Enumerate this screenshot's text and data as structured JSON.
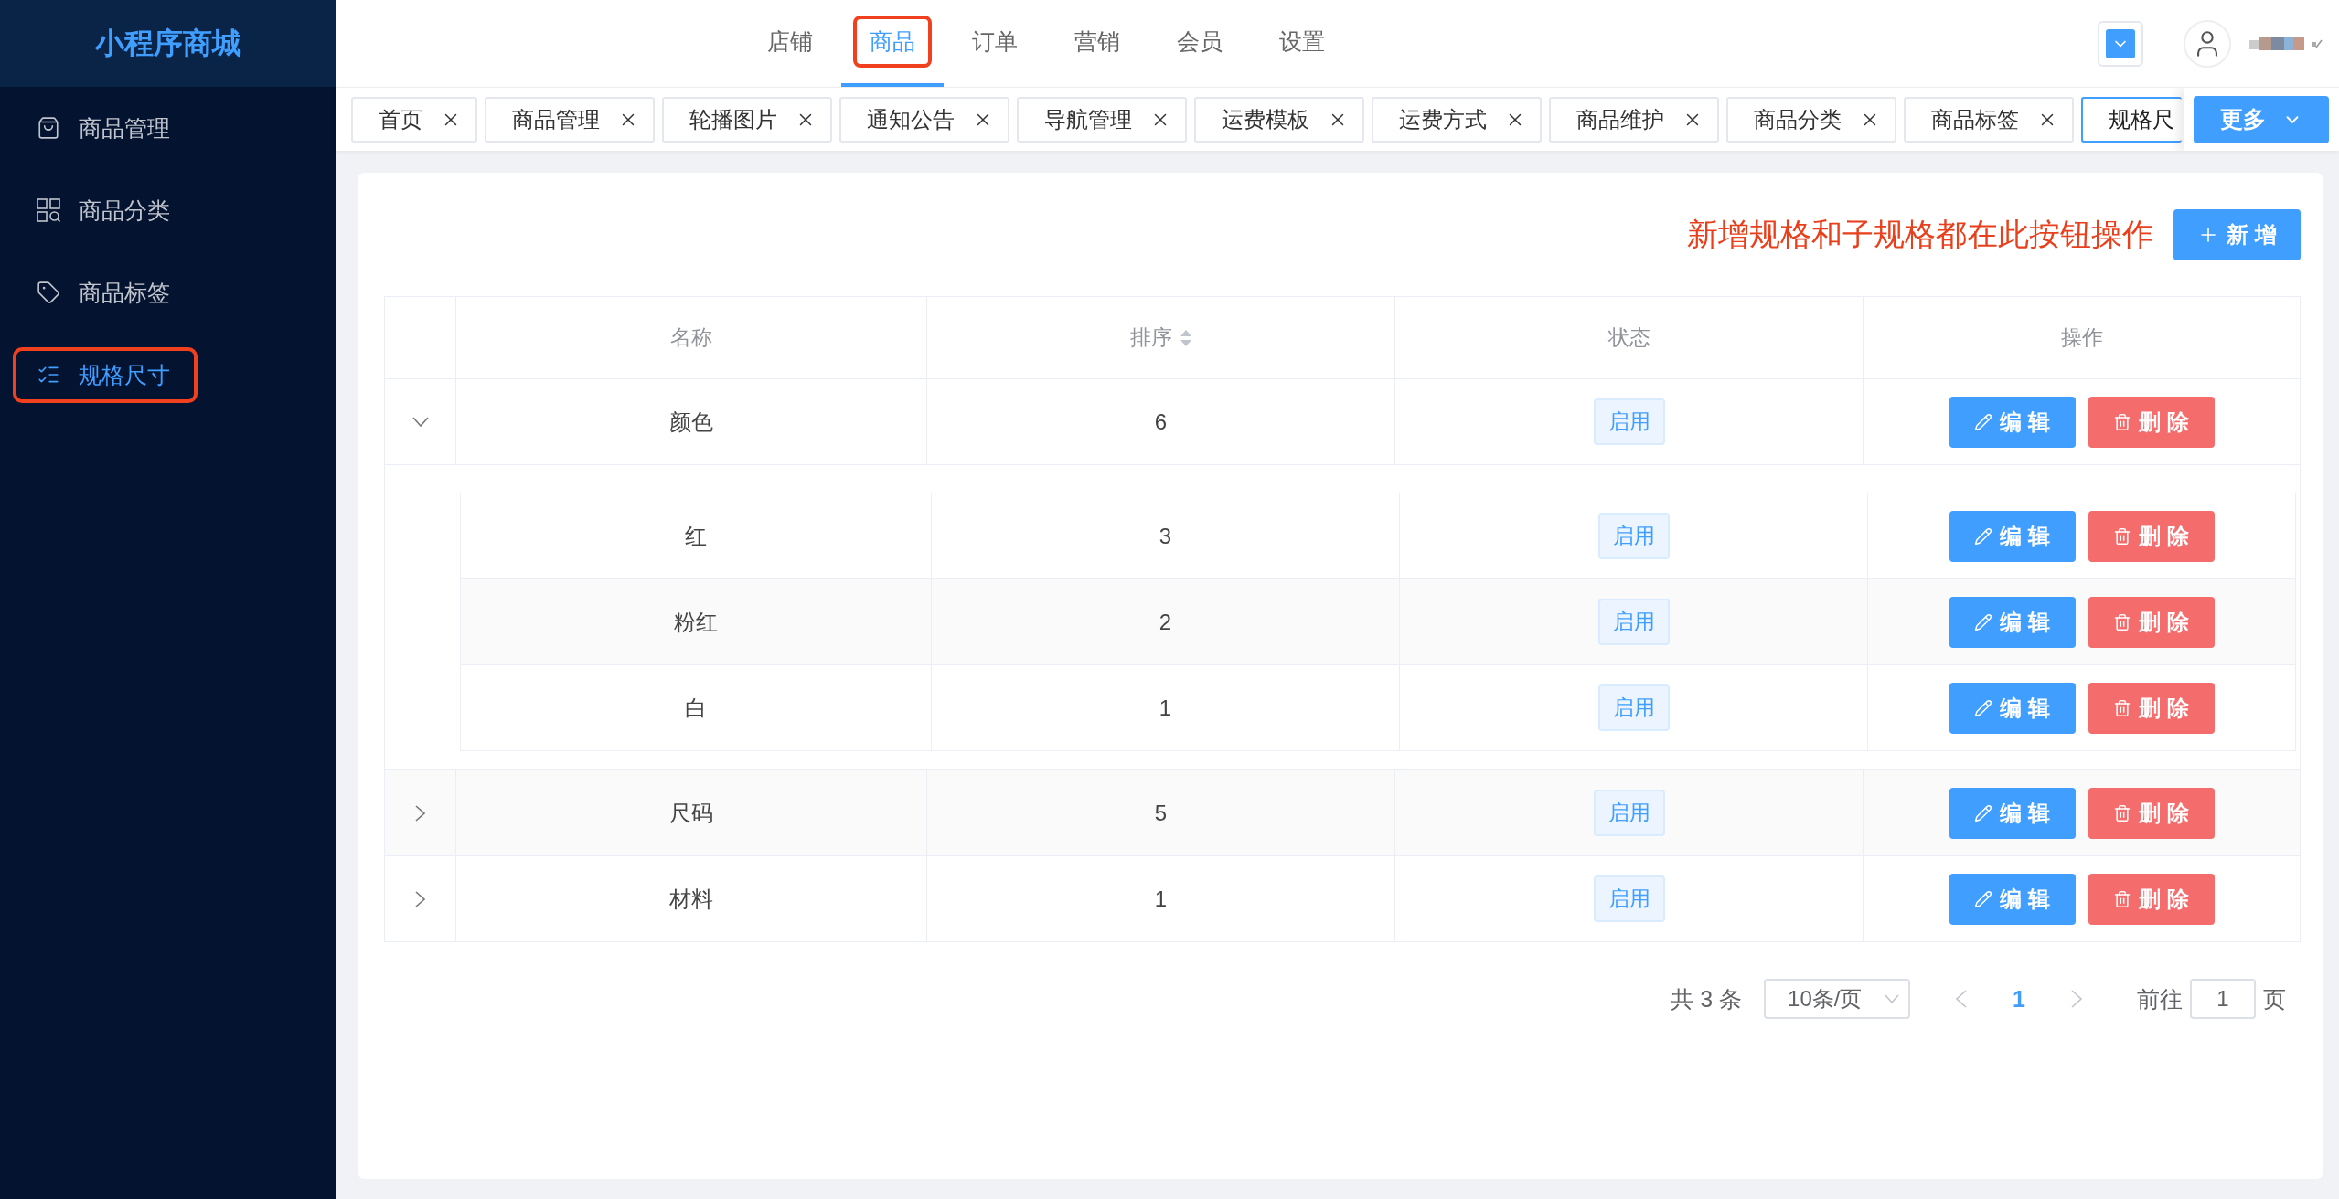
{
  "app": {
    "logo": "小程序商城"
  },
  "sidebar": {
    "items": [
      {
        "label": "商品管理",
        "kind": "bag",
        "selected": false,
        "annotated": false
      },
      {
        "label": "商品分类",
        "kind": "grid",
        "selected": false,
        "annotated": false
      },
      {
        "label": "商品标签",
        "kind": "tag",
        "selected": false,
        "annotated": false
      },
      {
        "label": "规格尺寸",
        "kind": "list",
        "selected": true,
        "annotated": true
      }
    ]
  },
  "top_nav": {
    "items": [
      {
        "label": "店铺",
        "selected": false,
        "annotated": false
      },
      {
        "label": "商品",
        "selected": true,
        "annotated": true
      },
      {
        "label": "订单",
        "selected": false,
        "annotated": false
      },
      {
        "label": "营销",
        "selected": false,
        "annotated": false
      },
      {
        "label": "会员",
        "selected": false,
        "annotated": false
      },
      {
        "label": "设置",
        "selected": false,
        "annotated": false
      }
    ]
  },
  "tabs": {
    "items": [
      {
        "label": "首页",
        "selected": false,
        "closable": true
      },
      {
        "label": "商品管理",
        "selected": false,
        "closable": true
      },
      {
        "label": "轮播图片",
        "selected": false,
        "closable": true
      },
      {
        "label": "通知公告",
        "selected": false,
        "closable": true
      },
      {
        "label": "导航管理",
        "selected": false,
        "closable": true
      },
      {
        "label": "运费模板",
        "selected": false,
        "closable": true
      },
      {
        "label": "运费方式",
        "selected": false,
        "closable": true
      },
      {
        "label": "商品维护",
        "selected": false,
        "closable": true
      },
      {
        "label": "商品分类",
        "selected": false,
        "closable": true
      },
      {
        "label": "商品标签",
        "selected": false,
        "closable": true
      },
      {
        "label": "规格尺",
        "selected": true,
        "closable": false
      }
    ],
    "more": "更多"
  },
  "toolbar": {
    "note": "新增规格和子规格都在此按钮操作",
    "add_button": "新 增"
  },
  "table": {
    "columns": [
      {
        "label": "名称",
        "sortable": false
      },
      {
        "label": "排序",
        "sortable": true
      },
      {
        "label": "状态",
        "sortable": false
      },
      {
        "label": "操作",
        "sortable": false
      }
    ],
    "rows": [
      {
        "name": "颜色",
        "sort": "6",
        "status": "启用",
        "edit": "编 辑",
        "delete": "删 除",
        "expanded": true,
        "children": [
          {
            "name": "红",
            "sort": "3",
            "status": "启用",
            "edit": "编 辑",
            "delete": "删 除"
          },
          {
            "name": "粉红",
            "sort": "2",
            "status": "启用",
            "edit": "编 辑",
            "delete": "删 除"
          },
          {
            "name": "白",
            "sort": "1",
            "status": "启用",
            "edit": "编 辑",
            "delete": "删 除"
          }
        ]
      },
      {
        "name": "尺码",
        "sort": "5",
        "status": "启用",
        "edit": "编 辑",
        "delete": "删 除",
        "expanded": false
      },
      {
        "name": "材料",
        "sort": "1",
        "status": "启用",
        "edit": "编 辑",
        "delete": "删 除",
        "expanded": false
      }
    ]
  },
  "pagination": {
    "total": "共 3 条",
    "page_size": "10条/页",
    "pages": [
      {
        "label": "1",
        "selected": true
      }
    ],
    "goto_label": "前往",
    "goto_value": "1",
    "goto_suffix": "页"
  }
}
